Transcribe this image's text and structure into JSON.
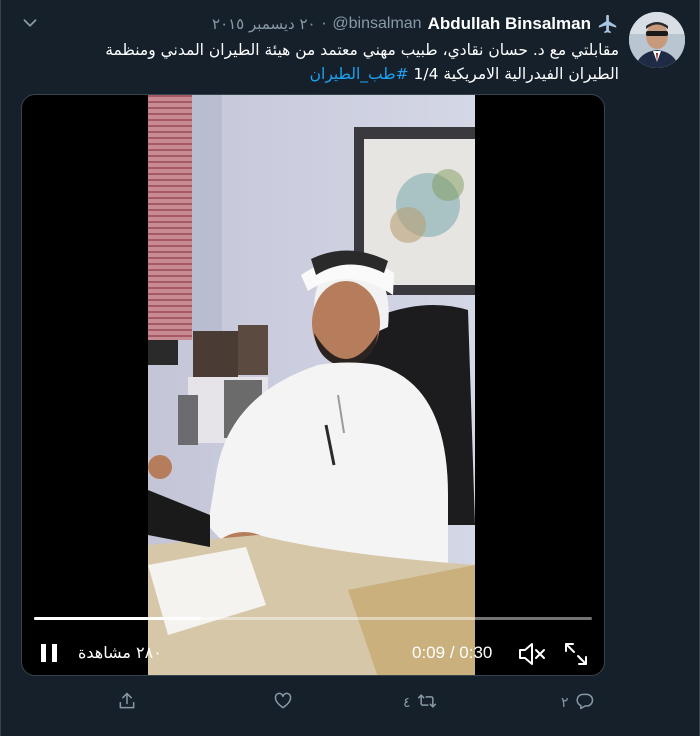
{
  "tweet": {
    "author_name": "Abdullah Binsalman",
    "handle": "@binsalman",
    "separator": "·",
    "date": "٢٠ ديسمبر ٢٠١٥",
    "text_line1": "مقابلتي مع د. حسان نقادي، طبيب مهني معتمد من هيئة الطيران المدني ومنظمة",
    "text_line2": "الطيران الفيدرالية الامريكية 1/4 ",
    "hashtag": "#طب_الطيران"
  },
  "video": {
    "current_time": "0:09",
    "duration": "0:30",
    "time_separator": " / ",
    "views": "٢٨٠ مشاهدة",
    "progress_fraction": 0.3
  },
  "actions": {
    "reply_count": "٢",
    "retweet_count": "٤",
    "like_count": "",
    "share_count": ""
  },
  "colors": {
    "background": "#15202b",
    "muted": "#8899a6",
    "link": "#1da1f2"
  },
  "icons": {
    "menu": "chevron-down-icon",
    "badge": "airplane-icon",
    "play": "pause-icon",
    "mute": "volume-muted-icon",
    "fullscreen": "fullscreen-icon",
    "reply": "reply-icon",
    "retweet": "retweet-icon",
    "like": "heart-icon",
    "share": "share-icon"
  }
}
